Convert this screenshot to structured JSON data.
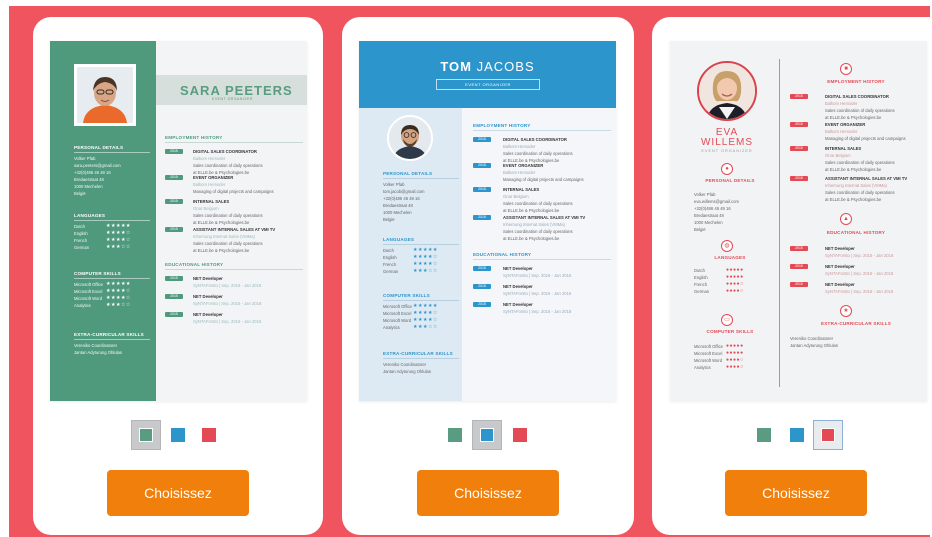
{
  "colors": {
    "page_bg": "#f0545e",
    "button": "#f07f0c",
    "green": "#4f9a7d",
    "blue": "#2c95cc",
    "red": "#e34a55"
  },
  "cards": [
    {
      "template": {
        "first_name": "SARA",
        "last_name": "PEETERS",
        "role": "EVENT ORGANIZER",
        "personal_title": "PERSONAL DETAILS",
        "personal": [
          "Volker Pfab",
          "sara.peeters@gmail.com",
          "+32(0)486 46 49 16",
          "Bredaestraat 48",
          "1000 Mechelen",
          "België"
        ],
        "languages_title": "LANGUAGES",
        "languages": [
          "Dutch",
          "English",
          "French",
          "German"
        ],
        "skills_title": "COMPUTER SKILLS",
        "skills": [
          "Microsoft Office",
          "Microsoft Excel",
          "Microsoft Word",
          "Analytics"
        ],
        "extra_title": "EXTRA-CURRICULAR SKILLS",
        "extra": [
          "Vereniko Coordinatorer",
          "Jantan Adyturung Ohlulas"
        ],
        "employment_title": "EMPLOYMENT HISTORY",
        "jobs": [
          {
            "title": "DIGITAL SALES COORDINATOR",
            "sub": "Balkom Hemoder",
            "line1": "Sales coordination of daily operations",
            "line2": "at ELLE.be & Psychologies.be"
          },
          {
            "title": "EVENT ORGANIZER",
            "sub": "Balkom Hemoder",
            "line1": "Managing of digital projects and campaigns",
            "line2": ""
          },
          {
            "title": "INTERNAL SALES",
            "sub": "Onar Belgium",
            "line1": "Sales coordination of daily operations",
            "line2": "at ELLE.be & Psychologies.be"
          },
          {
            "title": "ASSISTANT INTERNAL SALES AT VMI TV",
            "sub": "Inhernung Internat Sales (VMMa)",
            "line1": "Sales coordination of daily operations",
            "line2": "at ELLE.be & Psychologies.be"
          }
        ],
        "education_title": "EDUCATIONAL HISTORY",
        "education": [
          {
            "title": "NET Developer",
            "sub": "SyNTAForsto | Sep. 2016 - Jan 2018"
          },
          {
            "title": "NET Developer",
            "sub": "SyNTAForsto | Sep. 2016 - Jan 2018"
          },
          {
            "title": "NET Developer",
            "sub": "SyNTAForsto | Sep. 2016 - Jan 2018"
          }
        ],
        "year_tag": "2015"
      },
      "swatches": [
        "#5a9c82",
        "#2c95cc",
        "#e34a55"
      ],
      "selected_swatch": 0,
      "button_label": "Choisissez"
    },
    {
      "template": {
        "first_name": "TOM",
        "last_name": "JACOBS",
        "role": "EVENT ORGANIZER",
        "personal_title": "PERSONAL DETAILS",
        "personal": [
          "Volker Pfab",
          "tom.jacob@gmail.com",
          "+32(0)486 46 49 16",
          "Bredaestraat 48",
          "1000 Mechelen",
          "België"
        ],
        "languages_title": "LANGUAGES",
        "languages": [
          "Dutch",
          "English",
          "French",
          "German"
        ],
        "skills_title": "COMPUTER SKILLS",
        "skills": [
          "Microsoft Office",
          "Microsoft Excel",
          "Microsoft Word",
          "Analytics"
        ],
        "extra_title": "EXTRA-CURRICULAR SKILLS",
        "extra": [
          "Vereniko Coordinatorer",
          "Jantan Adyturung Ohlulas"
        ],
        "employment_title": "EMPLOYMENT HISTORY",
        "jobs": [
          {
            "title": "DIGITAL SALES COORDINATOR",
            "sub": "Balkom Hemoder",
            "line1": "Sales coordination of daily operations",
            "line2": "at ELLE.be & Psychologies.be"
          },
          {
            "title": "EVENT ORGANIZER",
            "sub": "Balkom Hemoder",
            "line1": "Managing of digital projects and campaigns",
            "line2": ""
          },
          {
            "title": "INTERNAL SALES",
            "sub": "Onar Belgium",
            "line1": "Sales coordination of daily operations",
            "line2": "at ELLE.be & Psychologies.be"
          },
          {
            "title": "ASSISTANT INTERNAL SALES AT VMI TV",
            "sub": "Inhernung Internat Sales (VMMa)",
            "line1": "Sales coordination of daily operations",
            "line2": "at ELLE.be & Psychologies.be"
          }
        ],
        "education_title": "EDUCATIONAL HISTORY",
        "education": [
          {
            "title": "NET Developer",
            "sub": "SyNTAForsto | Sep. 2016 - Jan 2018"
          },
          {
            "title": "NET Developer",
            "sub": "SyNTAForsto | Sep. 2016 - Jan 2018"
          },
          {
            "title": "NET Developer",
            "sub": "SyNTAForsto | Sep. 2016 - Jan 2018"
          }
        ],
        "year_tag": "2015"
      },
      "swatches": [
        "#5a9c82",
        "#2c95cc",
        "#e34a55"
      ],
      "selected_swatch": 1,
      "button_label": "Choisissez"
    },
    {
      "template": {
        "first_name": "EVA",
        "last_name": "WILLEMS",
        "role": "EVENT ORGANIZER",
        "personal_title": "PERSONAL DETAILS",
        "personal": [
          "Volker Pfab",
          "eva.willems@gmail.com",
          "+32(0)486 46 49 16",
          "Bredaestraat 48",
          "1000 Mechelen",
          "België"
        ],
        "languages_title": "LANGUAGES",
        "languages": [
          "Dutch",
          "English",
          "French",
          "German"
        ],
        "skills_title": "COMPUTER SKILLS",
        "skills": [
          "Microsoft Office",
          "Microsoft Excel",
          "Microsoft Word",
          "Analytics"
        ],
        "extra_title": "EXTRA-CURRICULAR SKILLS",
        "extra": [
          "Vereniko Coordinatorer",
          "Jantan Adyturung Ohlulas"
        ],
        "employment_title": "EMPLOYMENT HISTORY",
        "jobs": [
          {
            "title": "DIGITAL SALES COORDINATOR",
            "sub": "Balkom Hemoder",
            "line1": "Sales coordination of daily operations",
            "line2": "at ELLE.be & Psychologies.be"
          },
          {
            "title": "EVENT ORGANIZER",
            "sub": "Balkom Hemoder",
            "line1": "Managing of digital projects and campaigns",
            "line2": ""
          },
          {
            "title": "INTERNAL SALES",
            "sub": "Onar Belgium",
            "line1": "Sales coordination of daily operations",
            "line2": "at ELLE.be & Psychologies.be"
          },
          {
            "title": "ASSISTANT INTERNAL SALES AT VMI TV",
            "sub": "Inhernung Internat Sales (VMMa)",
            "line1": "Sales coordination of daily operations",
            "line2": "at ELLE.be & Psychologies.be"
          }
        ],
        "education_title": "EDUCATIONAL HISTORY",
        "education": [
          {
            "title": "NET Developer",
            "sub": "SyNTAForsto | Sep. 2016 - Jan 2018"
          },
          {
            "title": "NET Developer",
            "sub": "SyNTAForsto | Sep. 2016 - Jan 2018"
          },
          {
            "title": "NET Developer",
            "sub": "SyNTAForsto | Sep. 2016 - Jan 2018"
          }
        ],
        "year_tag": "2015"
      },
      "swatches": [
        "#5a9c82",
        "#2c95cc",
        "#e34a55"
      ],
      "selected_swatch": 2,
      "button_label": "Choisissez"
    }
  ]
}
